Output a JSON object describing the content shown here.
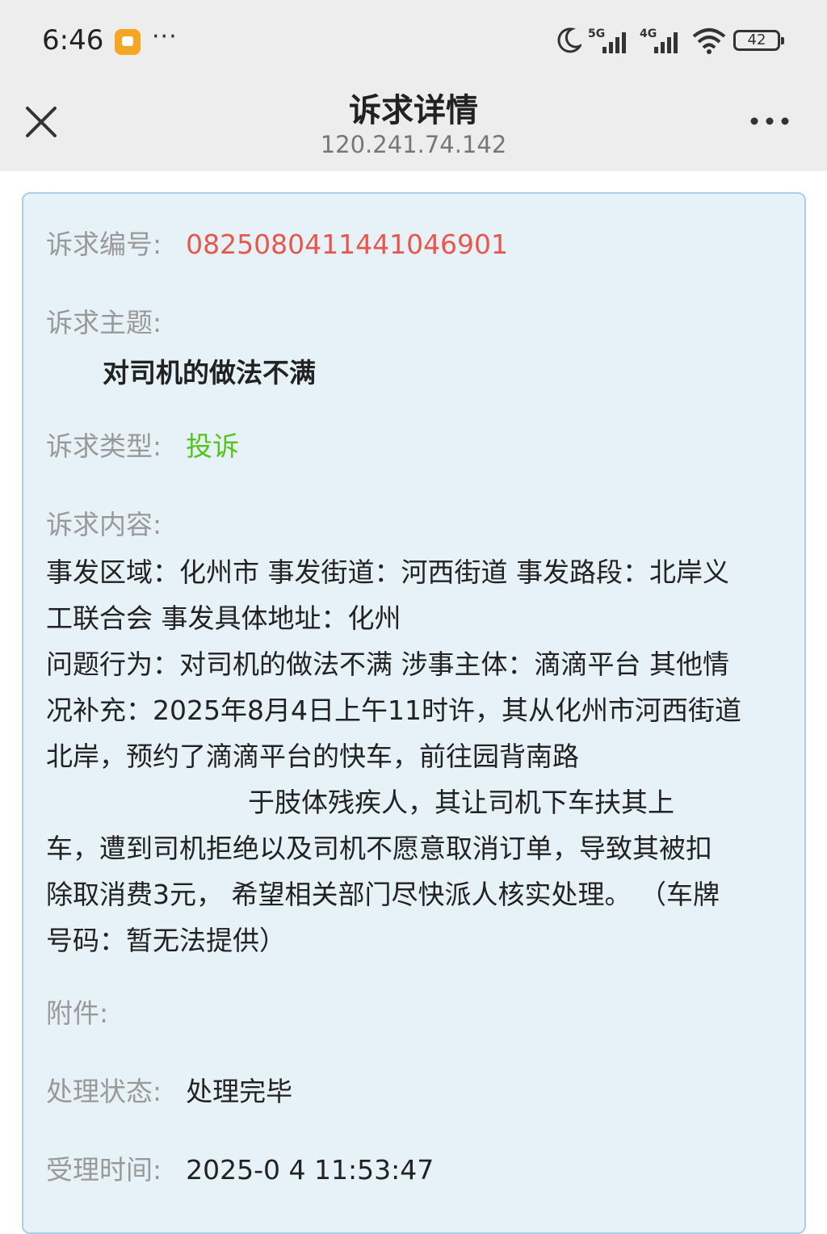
{
  "status_bar": {
    "time": "6:46",
    "more": "···",
    "net1": "5G",
    "net2": "4G",
    "battery": "42"
  },
  "header": {
    "title": "诉求详情",
    "subtitle": "120.241.74.142"
  },
  "detail": {
    "number_label": "诉求编号:",
    "number_value": "0825080411441046901",
    "topic_label": "诉求主题:",
    "topic_value": "对司机的做法不满",
    "type_label": "诉求类型:",
    "type_value": "投诉",
    "content_label": "诉求内容:",
    "content_lines": [
      "事发区域：化州市 事发街道：河西街道 事发路段：北岸义",
      "工联合会 事发具体地址：化州",
      "问题行为：对司机的做法不满 涉事主体：滴滴平台 其他情",
      "况补充：2025年8月4日上午11时许，其从化州市河西街道",
      "北岸，预约了滴滴平台的快车，前往园背南路",
      "于肢体残疾人，其让司机下车扶其上",
      "车，遭到司机拒绝以及司机不愿意取消订单，导致其被扣",
      "除取消费3元，  希望相关部门尽快派人核实处理。  （车牌",
      "号码：暂无法提供）"
    ],
    "attachment_label": "附件:",
    "status_label": "处理状态:",
    "status_value": "处理完毕",
    "time_label": "受理时间:",
    "time_value": "2025-0 4 11:53:47"
  }
}
